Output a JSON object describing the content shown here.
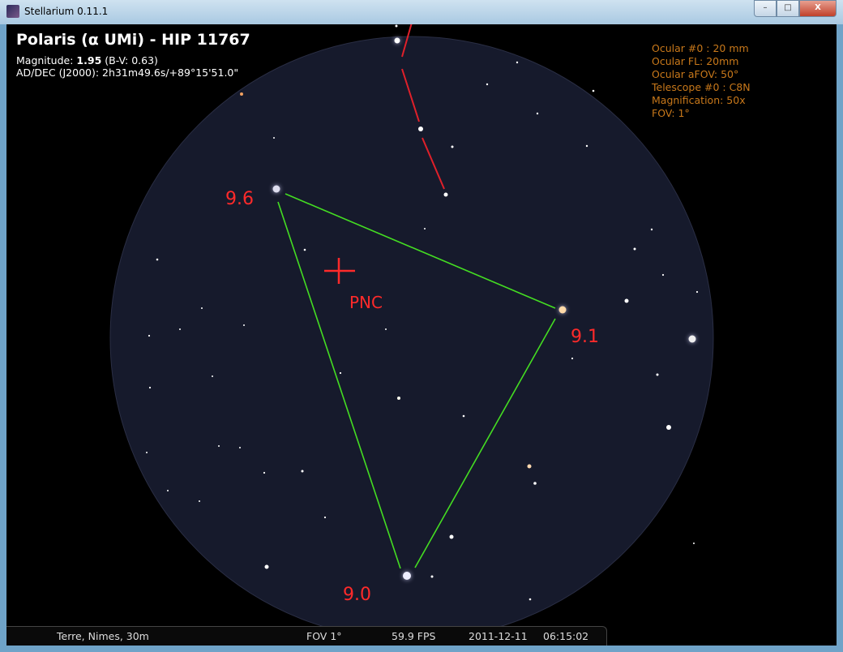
{
  "window": {
    "title": "Stellarium 0.11.1",
    "minimize": "–",
    "maximize": "□",
    "close": "X"
  },
  "object": {
    "title": "Polaris (α UMi) - HIP 11767",
    "magnitude_label": "Magnitude:",
    "magnitude": "1.95",
    "bv": "(B-V: 0.63)",
    "coords": "AD/DEC (J2000): 2h31m49.6s/+89°15'51.0\""
  },
  "ocular": [
    "Ocular #0 : 20 mm",
    "Ocular FL: 20mm",
    "Ocular aFOV: 50°",
    "Telescope #0 : C8N",
    "Magnification: 50x",
    "FOV: 1°"
  ],
  "status": {
    "location": "Terre, Nimes, 30m",
    "fov": "FOV 1°",
    "fps": "59.9 FPS",
    "date": "2011-12-11",
    "time": "06:15:02"
  },
  "annotations": {
    "a": "9.6",
    "b": "9.1",
    "c": "9.0",
    "pole": "PNC"
  },
  "colors": {
    "ocular_text": "#c8781a",
    "annotation": "#ff2a2a",
    "triangle": "#44dd22",
    "field": "#161a2c"
  }
}
